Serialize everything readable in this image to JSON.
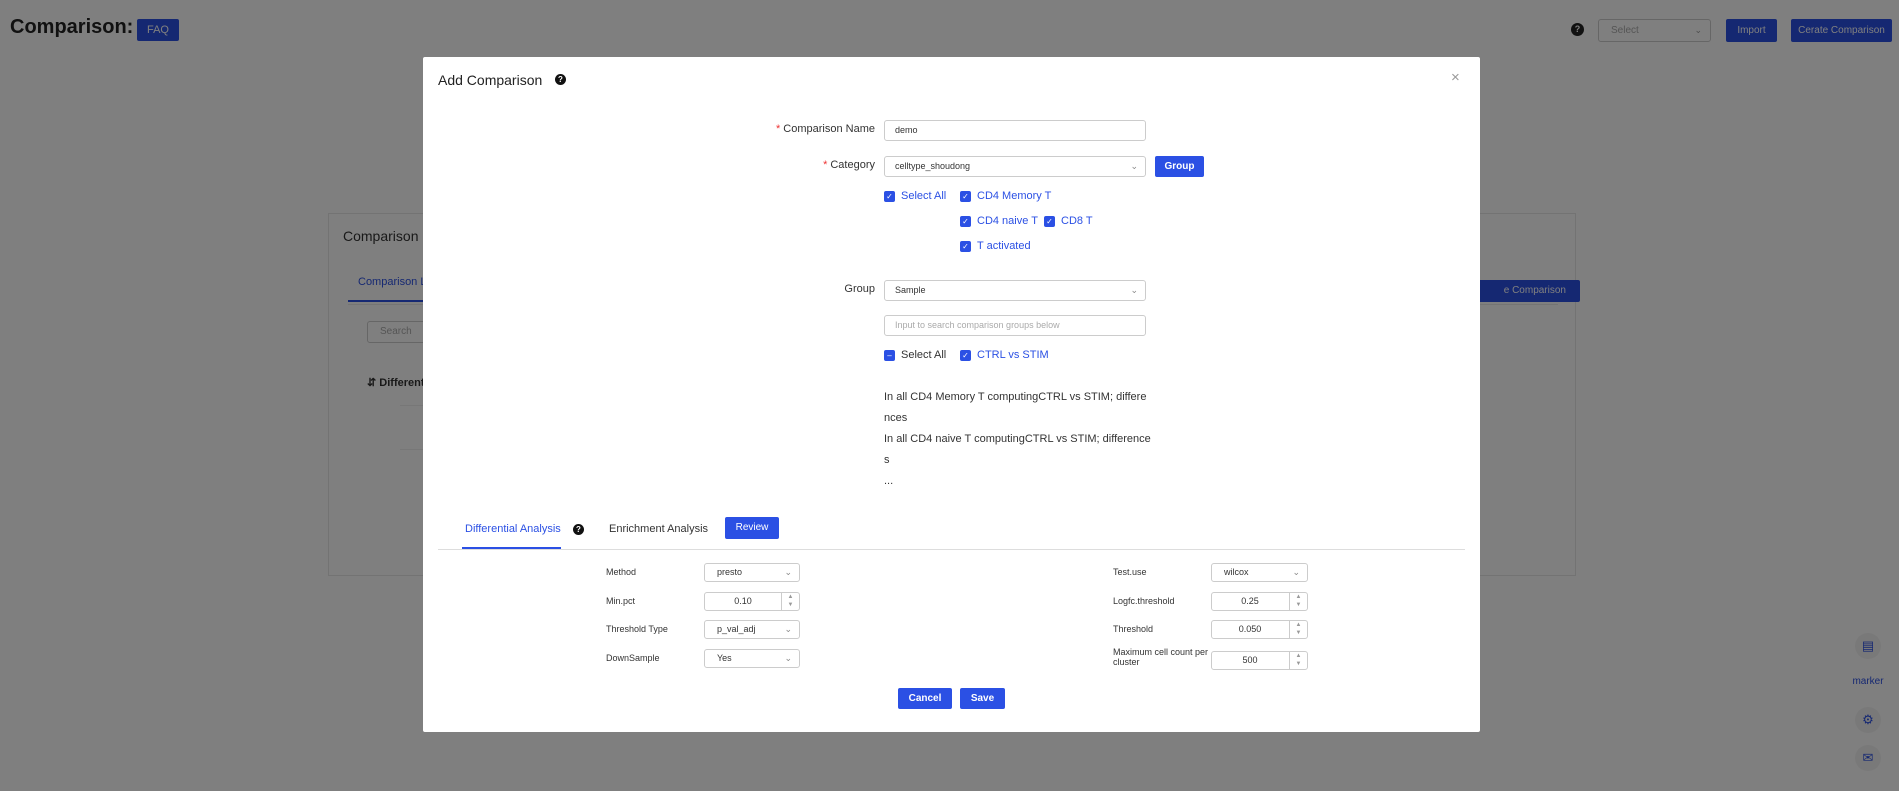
{
  "page": {
    "title": "Comparison:",
    "faq_label": "FAQ",
    "help_icon": "?",
    "select_placeholder": "Select",
    "import_label": "Import",
    "create_label": "Cerate Comparison"
  },
  "card": {
    "title": "Comparison",
    "tab_label": "Comparison L",
    "search_placeholder": "Search",
    "column_header": "Differentia",
    "create_label": "e Comparison"
  },
  "side": {
    "marker_label": "marker"
  },
  "modal": {
    "title": "Add Comparison",
    "help": "?",
    "close": "×",
    "comparison_name": {
      "label": "Comparison Name",
      "value": "demo"
    },
    "category": {
      "label": "Category",
      "value": "celltype_shoudong",
      "group_button": "Group",
      "select_all": "Select All",
      "options": [
        "CD4 Memory T",
        "CD4 naive T",
        "CD8 T",
        "T activated"
      ]
    },
    "group": {
      "label": "Group",
      "value": "Sample",
      "search_placeholder": "Input to search comparison groups below",
      "select_all": "Select All",
      "options": [
        "CTRL vs STIM"
      ]
    },
    "notes": [
      "In all CD4 Memory T computingCTRL vs STIM; differe",
      "nces",
      "In all CD4 naive T computingCTRL vs STIM; difference",
      "s",
      "..."
    ],
    "tabs": {
      "differential": "Differential Analysis",
      "enrichment": "Enrichment Analysis",
      "review": "Review"
    },
    "params": {
      "method": {
        "label": "Method",
        "value": "presto"
      },
      "min_pct": {
        "label": "Min.pct",
        "value": "0.10"
      },
      "threshold_type": {
        "label": "Threshold Type",
        "value": "p_val_adj"
      },
      "downsample": {
        "label": "DownSample",
        "value": "Yes"
      },
      "test_use": {
        "label": "Test.use",
        "value": "wilcox"
      },
      "logfc": {
        "label": "Logfc.threshold",
        "value": "0.25"
      },
      "threshold": {
        "label": "Threshold",
        "value": "0.050"
      },
      "max_cells": {
        "label": "Maximum cell count per cluster",
        "value": "500"
      }
    },
    "cancel": "Cancel",
    "save": "Save"
  }
}
